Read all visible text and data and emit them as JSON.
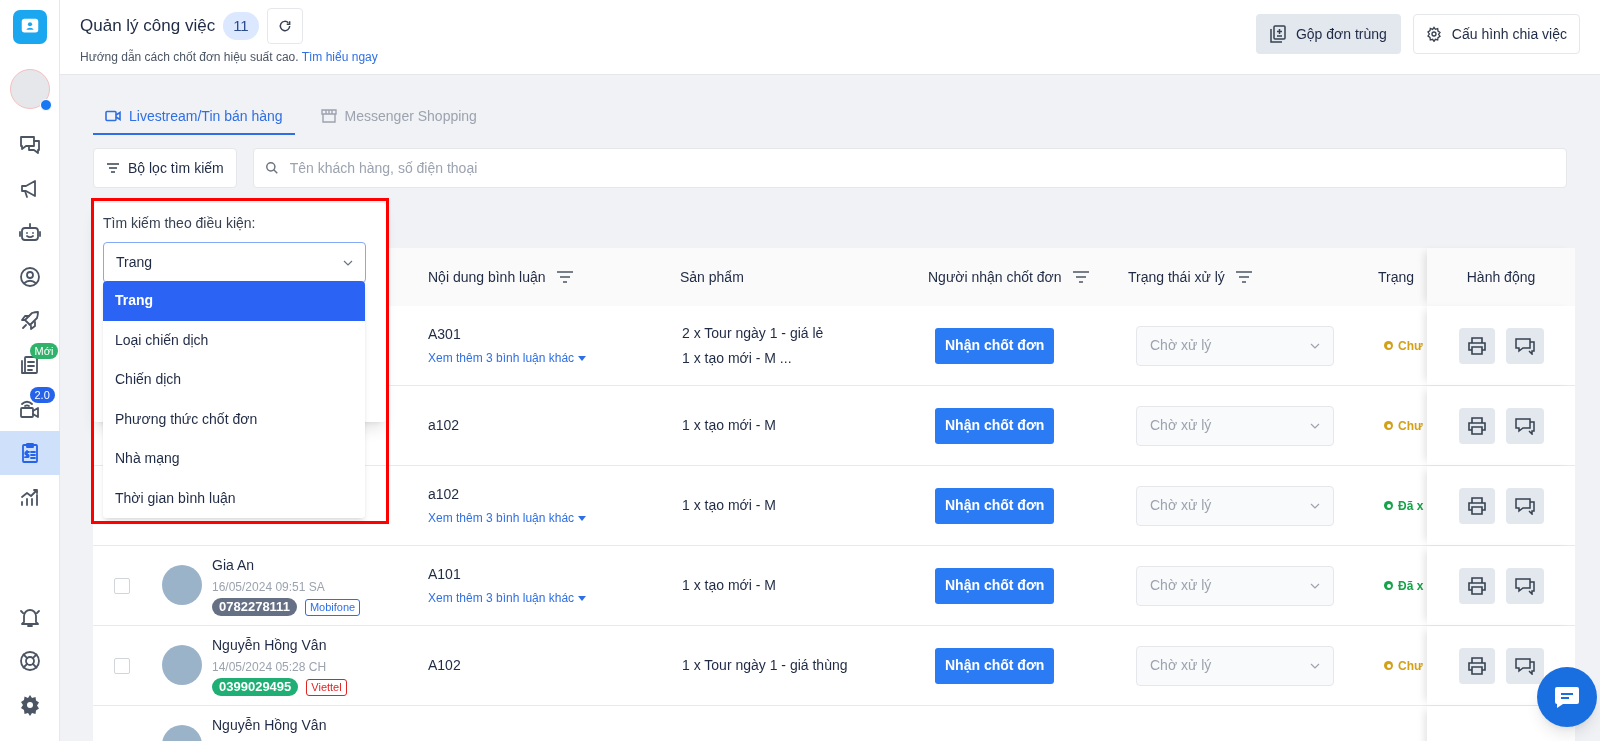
{
  "sidebar": {
    "items": [
      {
        "selected": false
      },
      {
        "selected": false
      },
      {
        "selected": false
      },
      {
        "selected": false
      },
      {
        "selected": false
      },
      {
        "badge": "Mới",
        "color": "#2fb36b",
        "selected": false
      },
      {
        "badge": "2.0",
        "color": "#2563eb",
        "selected": false
      },
      {
        "selected": true
      },
      {
        "selected": false
      }
    ]
  },
  "header": {
    "title": "Quản lý công việc",
    "count": "11",
    "subtitle": "Hướng dẫn cách chốt đơn hiệu suất cao.",
    "link": "Tìm hiểu ngay",
    "buttons": [
      {
        "label": "Gộp đơn trùng",
        "kind": "merge"
      },
      {
        "label": "Cấu hình chia việc",
        "kind": "settings"
      }
    ]
  },
  "tabs": [
    {
      "label": "Livestream/Tin bán hàng",
      "selected": true
    },
    {
      "label": "Messenger Shopping",
      "selected": false
    }
  ],
  "filter_button": "Bộ lọc tìm kiếm",
  "search": {
    "placeholder": "Tên khách hàng, số điện thoại"
  },
  "filter_panel": {
    "label": "Tìm kiếm theo điều kiện:",
    "value": "Trang",
    "options": [
      {
        "label": "Trang",
        "selected": true
      },
      {
        "label": "Loại chiến dịch",
        "selected": false
      },
      {
        "label": "Chiến dịch",
        "selected": false
      },
      {
        "label": "Phương thức chốt đơn",
        "selected": false
      },
      {
        "label": "Nhà mạng",
        "selected": false
      },
      {
        "label": "Thời gian bình luận",
        "selected": false
      }
    ]
  },
  "table": {
    "columns": [
      {
        "label": "Nội dung bình luận",
        "filter": true
      },
      {
        "label": "Sản phẩm",
        "filter": false
      },
      {
        "label": "Người nhận chốt đơn",
        "filter": true
      },
      {
        "label": "Trạng thái xử lý",
        "filter": true
      },
      {
        "label": "Trạng",
        "filter": false
      },
      {
        "label": "Hành động",
        "filter": false
      }
    ],
    "rows": [
      {
        "comment": "A301",
        "more": "Xem thêm 3 bình luận khác",
        "products": [
          "2 x Tour ngày 1 - giá lẻ",
          "1 x tạo mới - M ..."
        ],
        "assign": "Nhận chốt đơn",
        "status": "Chờ xử lý",
        "state": {
          "label": "Chư",
          "color": "#d4a017"
        }
      },
      {
        "comment": "a102",
        "products": [
          "1 x tạo mới - M"
        ],
        "assign": "Nhận chốt đơn",
        "status": "Chờ xử lý",
        "state": {
          "label": "Chư",
          "color": "#d4a017"
        }
      },
      {
        "comment": "a102",
        "more": "Xem thêm 3 bình luận khác",
        "products": [
          "1 x tạo mới - M"
        ],
        "assign": "Nhận chốt đơn",
        "status": "Chờ xử lý",
        "state": {
          "label": "Đã x",
          "color": "#16a34a"
        }
      },
      {
        "checked": false,
        "name": "Gia An",
        "time": "16/05/2024 09:51 SA",
        "phone": {
          "label": "0782278111",
          "color": "#667085"
        },
        "carrier": {
          "label": "Mobifone",
          "color": "#2f6fe4"
        },
        "comment": "A101",
        "more": "Xem thêm 3 bình luận khác",
        "products": [
          "1 x tạo mới - M"
        ],
        "assign": "Nhận chốt đơn",
        "status": "Chờ xử lý",
        "state": {
          "label": "Đã x",
          "color": "#16a34a"
        }
      },
      {
        "checked": false,
        "name": "Nguyễn Hồng Vân",
        "time": "14/05/2024 05:28 CH",
        "phone": {
          "label": "0399029495",
          "color": "#1fae74"
        },
        "carrier": {
          "label": "Viettel",
          "color": "#e02424"
        },
        "comment": "A102",
        "products": [
          "1 x Tour ngày 1 - giá thùng"
        ],
        "assign": "Nhận chốt đơn",
        "status": "Chờ xử lý",
        "state": {
          "label": "Chư",
          "color": "#d4a017"
        }
      },
      {
        "name": "Nguyễn Hồng Vân"
      }
    ]
  }
}
